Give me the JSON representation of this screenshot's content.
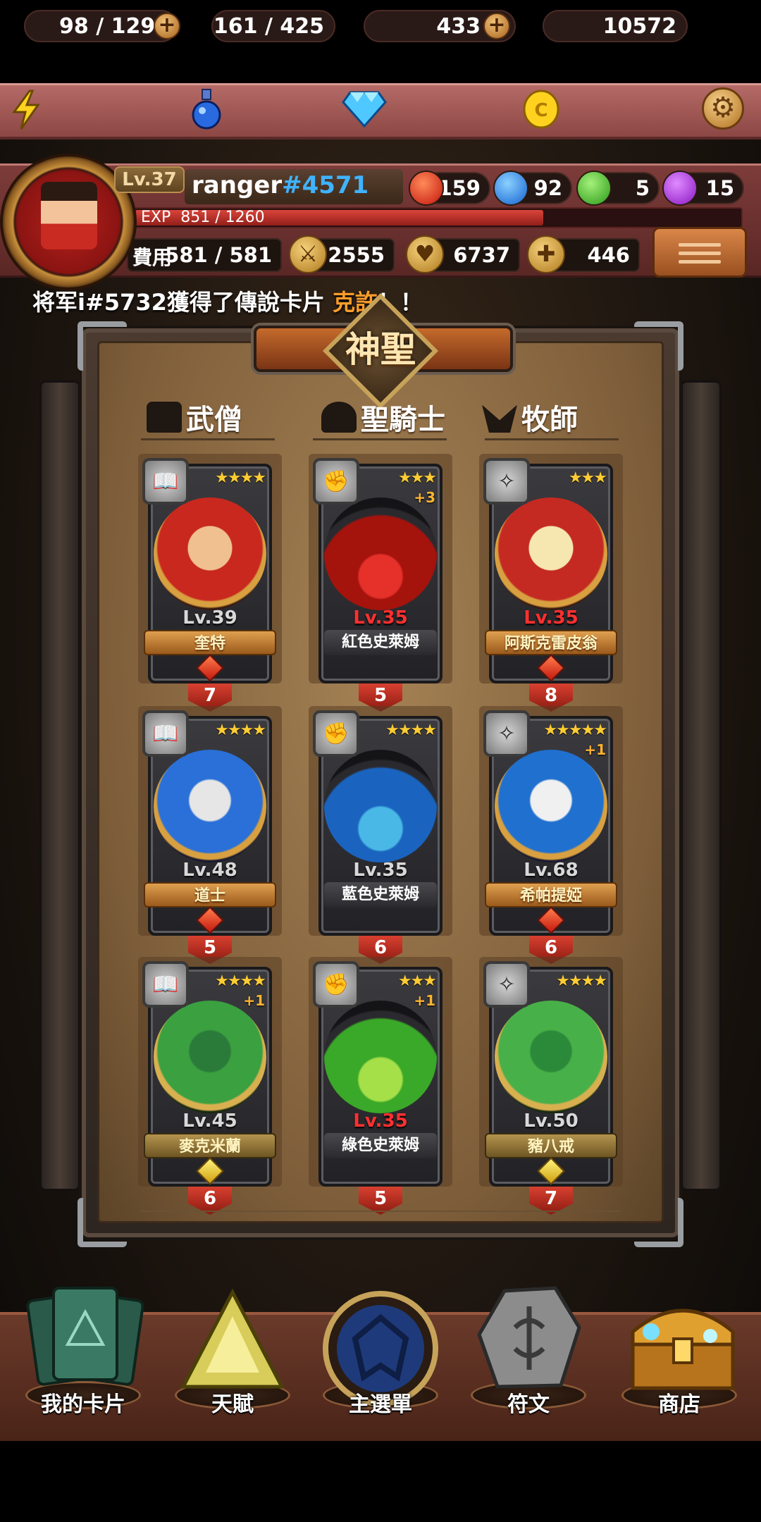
{
  "resources": {
    "stamina": "98 / 129",
    "potion": "161 / 425",
    "gems": "433",
    "gold": "10572"
  },
  "profile": {
    "level": "Lv.37",
    "name": "ranger",
    "tag": "#4571",
    "exp_label": "EXP",
    "exp_value": "851 / 1260",
    "exp_fraction": 0.675,
    "orbs": {
      "fire": "159",
      "water": "92",
      "nature": "5",
      "dark": "15"
    },
    "cost_label": "費用",
    "cost_value": "581 / 581",
    "attack": "2555",
    "hp": "6737",
    "heal": "446"
  },
  "ticker": {
    "prefix": "将军i#5732獲得了傳說卡片 ",
    "highlight": "克許",
    "suffix": "！！"
  },
  "board": {
    "title": "神聖",
    "columns": [
      "武僧",
      "聖騎士",
      "牧師"
    ]
  },
  "cards": [
    {
      "stars": "★★★★",
      "plus": "",
      "level": "Lv.39",
      "name": "奎特",
      "cost": "7"
    },
    {
      "stars": "★★★",
      "plus": "+3",
      "level": "Lv.35",
      "name": "紅色史萊姆",
      "cost": "5"
    },
    {
      "stars": "★★★",
      "plus": "",
      "level": "Lv.35",
      "name": "阿斯克雷皮翁",
      "cost": "8"
    },
    {
      "stars": "★★★★",
      "plus": "",
      "level": "Lv.48",
      "name": "道士",
      "cost": "5"
    },
    {
      "stars": "★★★★",
      "plus": "",
      "level": "Lv.35",
      "name": "藍色史萊姆",
      "cost": "6"
    },
    {
      "stars": "★★★★★",
      "plus": "+1",
      "level": "Lv.68",
      "name": "希帕提婭",
      "cost": "6"
    },
    {
      "stars": "★★★★",
      "plus": "+1",
      "level": "Lv.45",
      "name": "麥克米蘭",
      "cost": "6"
    },
    {
      "stars": "★★★",
      "plus": "+1",
      "level": "Lv.35",
      "name": "綠色史萊姆",
      "cost": "5"
    },
    {
      "stars": "★★★★",
      "plus": "",
      "level": "Lv.50",
      "name": "豬八戒",
      "cost": "7"
    }
  ],
  "nav": [
    "我的卡片",
    "天賦",
    "主選單",
    "符文",
    "商店"
  ],
  "colors": {
    "accent": "#ff9d2a",
    "tag_blue": "#3fb3ff",
    "level_red": "#ff3030"
  }
}
